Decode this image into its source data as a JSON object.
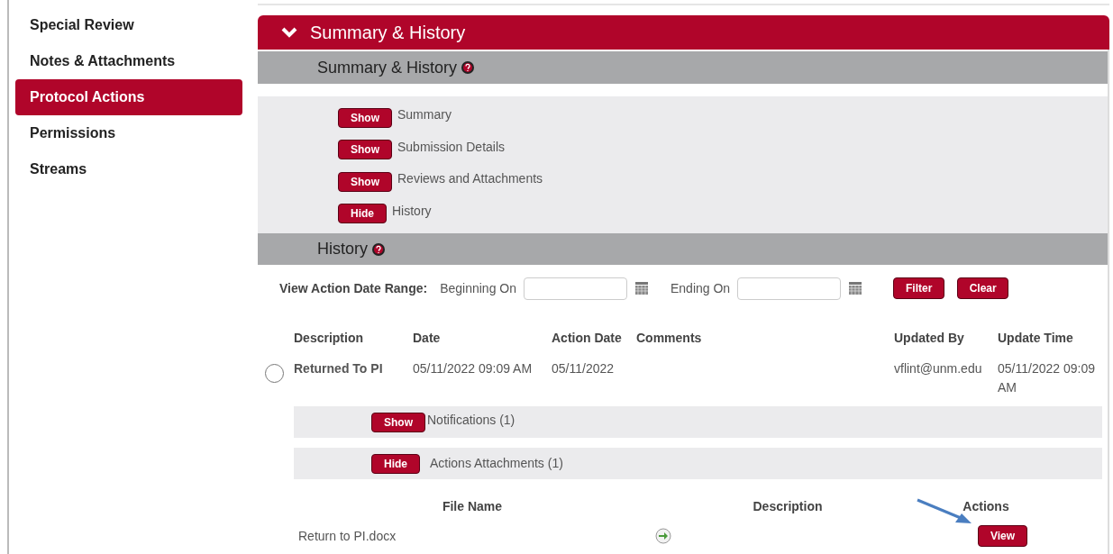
{
  "sidebar": {
    "items": [
      {
        "label": "Special Review",
        "selected": false
      },
      {
        "label": "Notes & Attachments",
        "selected": false
      },
      {
        "label": "Protocol Actions",
        "selected": true
      },
      {
        "label": "Permissions",
        "selected": false
      },
      {
        "label": "Streams",
        "selected": false
      }
    ]
  },
  "panel": {
    "title": "Summary & History",
    "expanded": true,
    "subheader": "Summary & History",
    "toggles": [
      {
        "button": "Show",
        "label": "Summary",
        "expanded": false
      },
      {
        "button": "Show",
        "label": "Submission Details",
        "expanded": false
      },
      {
        "button": "Show",
        "label": "Reviews and Attachments",
        "expanded": false
      },
      {
        "button": "Hide",
        "label": "History",
        "expanded": true
      }
    ]
  },
  "history": {
    "title": "History",
    "filter": {
      "label": "View Action Date Range:",
      "begin_label": "Beginning On",
      "end_label": "Ending On",
      "buttons": [
        "Filter",
        "Clear"
      ]
    },
    "columns": [
      "Description",
      "Date",
      "Action Date",
      "Comments",
      "Updated By",
      "Update Time"
    ],
    "rows": [
      {
        "selected": false,
        "cells": [
          "Returned To PI",
          "05/11/2022 09:09 AM",
          "05/11/2022",
          "",
          "vflint@unm.edu",
          "05/11/2022 09:09 AM"
        ],
        "subsections": [
          {
            "button": "Show",
            "label": "Notifications (1)",
            "expanded": false
          },
          {
            "button": "Hide",
            "label": "Actions Attachments (1)",
            "expanded": true
          }
        ],
        "attachments": {
          "columns": [
            "File Name",
            "Description",
            "Actions"
          ],
          "files": [
            {
              "name": "Return to PI.docx",
              "action": "View"
            }
          ]
        }
      }
    ]
  }
}
